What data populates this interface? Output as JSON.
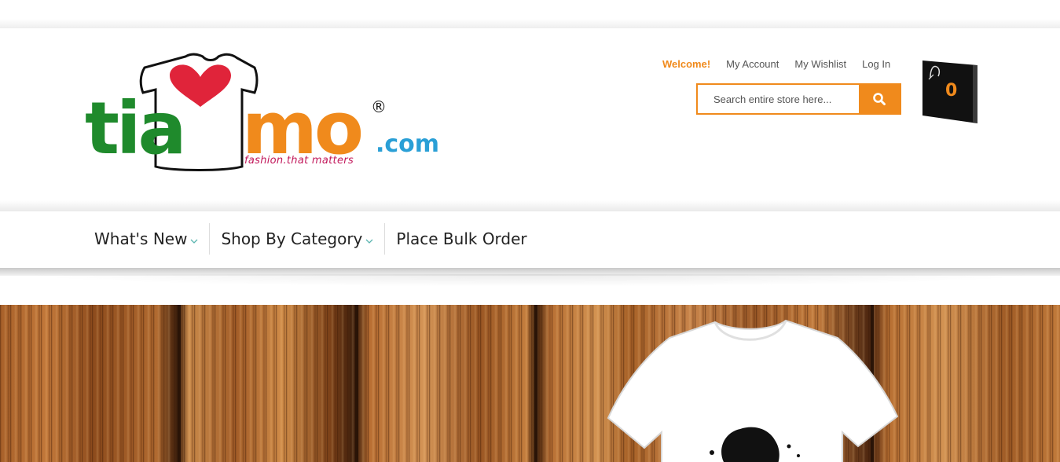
{
  "logo": {
    "word_left": "tia",
    "word_right": "mo",
    "registered": "®",
    "domain": ".com",
    "tagline": "fashion.that matters"
  },
  "top_links": {
    "welcome": "Welcome!",
    "account": "My Account",
    "wishlist": "My Wishlist",
    "login": "Log In"
  },
  "search": {
    "placeholder": "Search entire store here...",
    "button_icon": "search-icon"
  },
  "cart": {
    "count": "0",
    "icon": "shopping-bag-icon"
  },
  "nav": {
    "items": [
      {
        "label": "What's New",
        "has_dropdown": true
      },
      {
        "label": "Shop By Category",
        "has_dropdown": true
      },
      {
        "label": "Place Bulk Order",
        "has_dropdown": false
      }
    ]
  },
  "colors": {
    "accent": "#f08a1c",
    "logo_green": "#1f8a2c",
    "logo_blue": "#2a9fd6",
    "heart_red": "#e0243a",
    "chevron": "#5bb5b0"
  }
}
